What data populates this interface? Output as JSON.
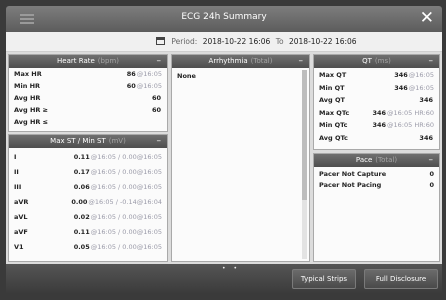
{
  "window": {
    "title": "ECG 24h Summary",
    "close_glyph": "✕",
    "menu_icon": "menu-icon"
  },
  "period": {
    "label": "Period:",
    "start": "2018-10-22 16:06",
    "to": "To",
    "end": "2018-10-22 16:06"
  },
  "heart_rate": {
    "title": "Heart Rate",
    "unit": "(bpm)",
    "rows": [
      {
        "label": "Max HR",
        "value": "86",
        "unit": "@16:05"
      },
      {
        "label": "Min HR",
        "value": "60",
        "unit": "@16:05"
      },
      {
        "label": "Avg HR",
        "value": "60",
        "unit": ""
      },
      {
        "label": "Avg HR ≥",
        "value": "60",
        "unit": ""
      },
      {
        "label": "Avg HR ≤",
        "value": "",
        "unit": ""
      }
    ]
  },
  "st": {
    "title": "Max ST / Min ST",
    "unit": "(mV)",
    "rows": [
      {
        "label": "I",
        "value": "0.11",
        "unit": "@16:05 / 0.00@16:05"
      },
      {
        "label": "II",
        "value": "0.17",
        "unit": "@16:05 / 0.00@16:05"
      },
      {
        "label": "III",
        "value": "0.06",
        "unit": "@16:05 / 0.00@16:05"
      },
      {
        "label": "aVR",
        "value": "0.00",
        "unit": "@16:05 / -0.14@16:04"
      },
      {
        "label": "aVL",
        "value": "0.02",
        "unit": "@16:05 / 0.00@16:05"
      },
      {
        "label": "aVF",
        "value": "0.11",
        "unit": "@16:05 / 0.00@16:05"
      },
      {
        "label": "V1",
        "value": "0.05",
        "unit": "@16:05 / 0.00@16:05"
      }
    ]
  },
  "arrhythmia": {
    "title": "Arrhythmia",
    "unit": "(Total)",
    "rows": [
      {
        "label": "None"
      }
    ]
  },
  "qt": {
    "title": "QT",
    "unit": "(ms)",
    "rows": [
      {
        "label": "Max QT",
        "value": "346",
        "unit": "@16:05"
      },
      {
        "label": "Min QT",
        "value": "346",
        "unit": "@16:05"
      },
      {
        "label": "Avg QT",
        "value": "346",
        "unit": ""
      },
      {
        "label": "Max QTc",
        "value": "346",
        "unit": "@16:05 HR:60"
      },
      {
        "label": "Min QTc",
        "value": "346",
        "unit": "@16:05 HR:60"
      },
      {
        "label": "Avg QTc",
        "value": "346",
        "unit": ""
      }
    ]
  },
  "pace": {
    "title": "Pace",
    "unit": "(Total)",
    "rows": [
      {
        "label": "Pacer Not Capture",
        "value": "0"
      },
      {
        "label": "Pacer Not Pacing",
        "value": "0"
      }
    ]
  },
  "bottom": {
    "page_dots": "• •",
    "typical_strips": "Typical Strips",
    "full_disclosure": "Full Disclosure"
  }
}
